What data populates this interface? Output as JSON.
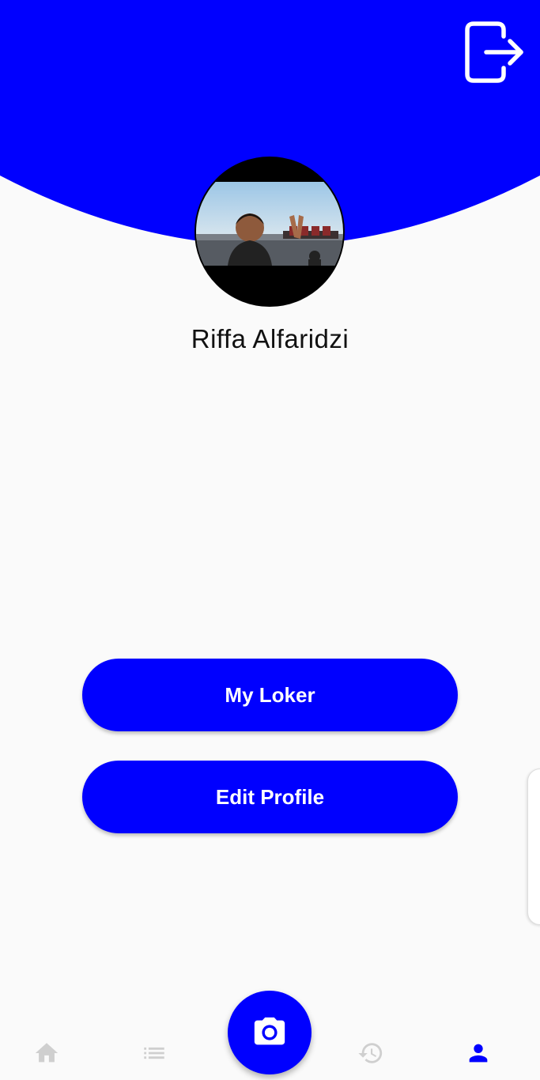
{
  "header": {
    "logout_icon": "logout-icon",
    "accent_color": "#0000ff"
  },
  "profile": {
    "name": "Riffa Alfaridzi",
    "avatar_icon": "profile-photo"
  },
  "actions": {
    "my_loker_label": "My Loker",
    "edit_profile_label": "Edit Profile"
  },
  "bottom_nav": {
    "items": [
      {
        "icon": "home-icon",
        "active": false
      },
      {
        "icon": "list-icon",
        "active": false
      },
      {
        "icon": "camera-icon",
        "active": false
      },
      {
        "icon": "history-icon",
        "active": false
      },
      {
        "icon": "person-icon",
        "active": true
      }
    ],
    "active_color": "#0000ff",
    "inactive_color": "#cfcfcf"
  }
}
